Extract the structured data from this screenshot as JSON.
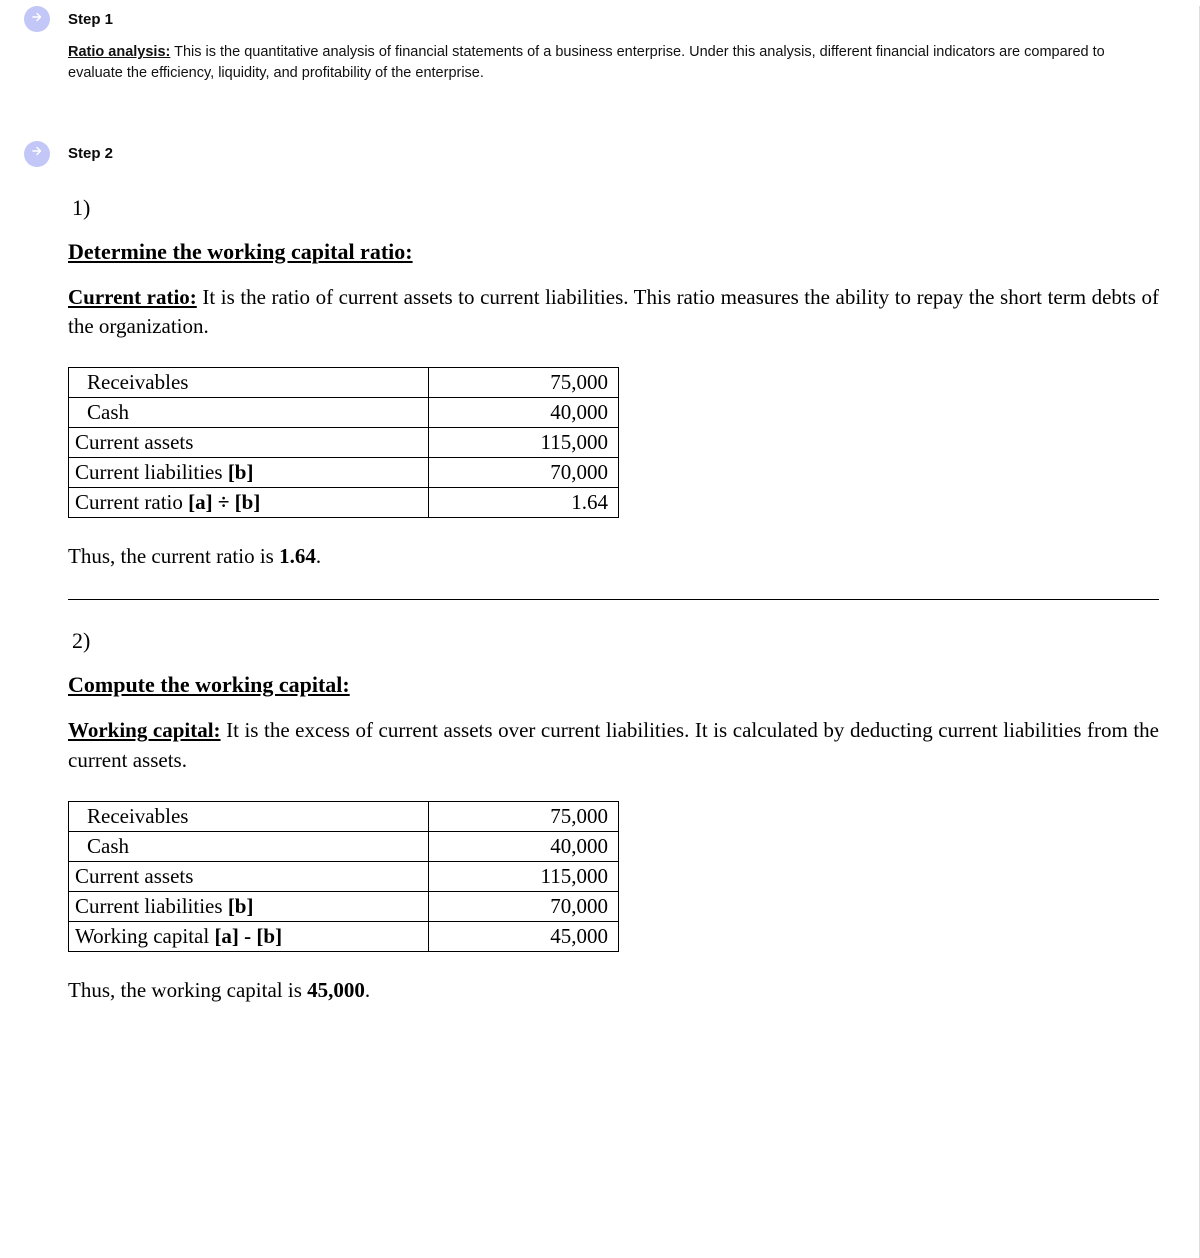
{
  "step1": {
    "label": "Step 1",
    "term": "Ratio analysis:",
    "text": " This is the quantitative analysis of financial statements of a business enterprise. Under this analysis, different financial indicators are compared to evaluate the efficiency, liquidity, and profitability of the enterprise."
  },
  "step2": {
    "label": "Step 2",
    "part1": {
      "marker": "1)",
      "heading": "Determine the working capital ratio:",
      "def_term": "Current ratio:",
      "def_text": " It is the ratio of current assets to current liabilities. This ratio measures the ability to repay the short term debts of the organization.",
      "rows": [
        {
          "label": "Receivables",
          "indent": true,
          "val": "75,000",
          "b_label": ""
        },
        {
          "label": "Cash",
          "indent": true,
          "val": "40,000",
          "b_label": ""
        },
        {
          "label": "Current assets",
          "indent": false,
          "val": "115,000",
          "b_label": ""
        },
        {
          "label": "Current liabilities ",
          "indent": false,
          "val": "70,000",
          "b_label": "[b]"
        },
        {
          "label": "Current ratio ",
          "indent": false,
          "val": "1.64",
          "b_label": "[a] ÷ [b]"
        }
      ],
      "conclude_pre": "Thus, the current ratio is ",
      "conclude_val": "1.64",
      "conclude_post": "."
    },
    "part2": {
      "marker": "2)",
      "heading": "Compute the working capital:",
      "def_term": "Working capital:",
      "def_text": " It is the excess of current assets over current liabilities. It is calculated by deducting current liabilities from the current assets.",
      "rows": [
        {
          "label": "Receivables",
          "indent": true,
          "val": "75,000",
          "b_label": ""
        },
        {
          "label": "Cash",
          "indent": true,
          "val": "40,000",
          "b_label": ""
        },
        {
          "label": "Current assets",
          "indent": false,
          "val": "115,000",
          "b_label": ""
        },
        {
          "label": "Current liabilities ",
          "indent": false,
          "val": "70,000",
          "b_label": "[b]"
        },
        {
          "label": "Working capital ",
          "indent": false,
          "val": "45,000",
          "b_label": "[a] - [b]"
        }
      ],
      "conclude_pre": "Thus, the working capital is ",
      "conclude_val": "45,000",
      "conclude_post": "."
    }
  }
}
